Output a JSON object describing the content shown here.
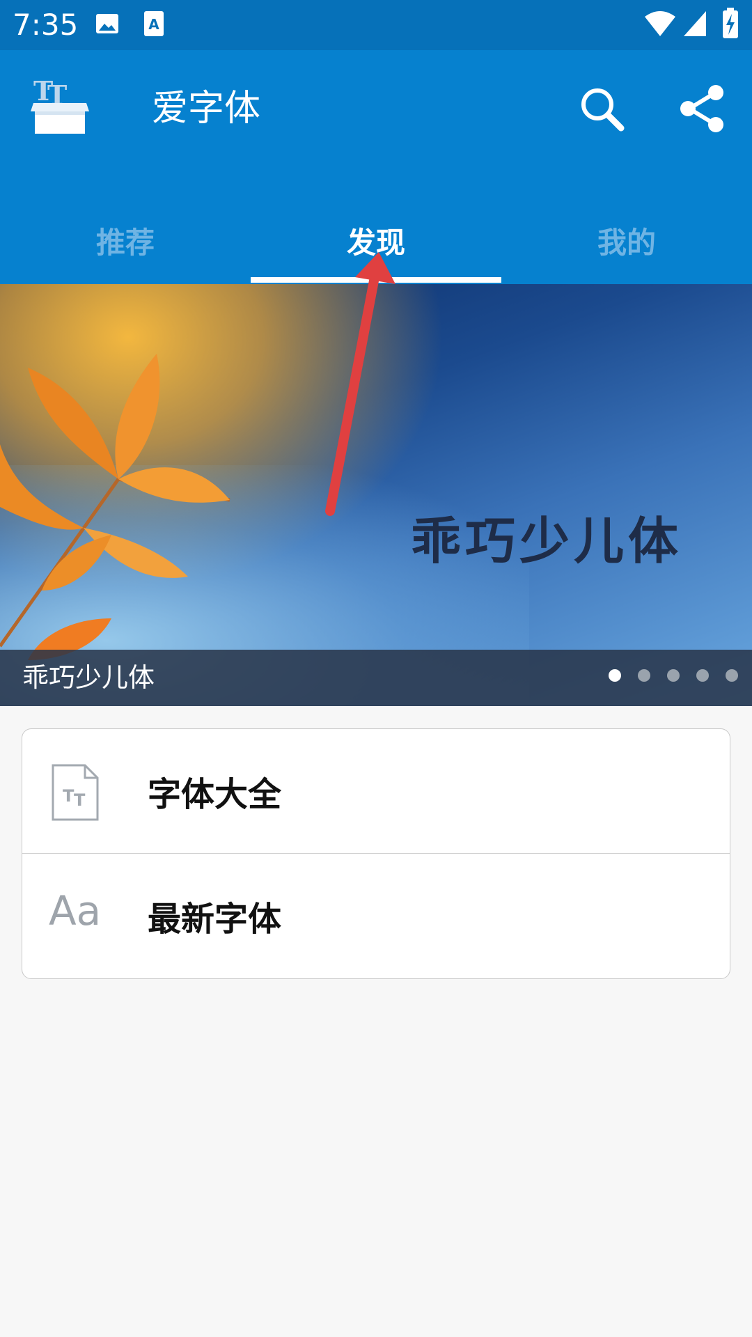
{
  "status_bar": {
    "time": "7:35",
    "icons": [
      "image-icon",
      "font-app-icon",
      "wifi-icon",
      "signal-icon",
      "battery-icon"
    ]
  },
  "app_bar": {
    "title": "爱字体",
    "actions": [
      "search-icon",
      "share-icon"
    ]
  },
  "tabs": [
    {
      "label": "推荐",
      "active": false
    },
    {
      "label": "发现",
      "active": true
    },
    {
      "label": "我的",
      "active": false
    }
  ],
  "banner": {
    "art_text": "乖巧少儿体",
    "caption": "乖巧少儿体",
    "page_count": 5,
    "active_index": 0
  },
  "menu": [
    {
      "label": "字体大全",
      "icon": "font-document-icon"
    },
    {
      "label": "最新字体",
      "icon": "aa-icon",
      "icon_text": "Aa"
    }
  ],
  "colors": {
    "status_bar": "#0671b9",
    "app_bar": "#0681cf",
    "tab_inactive": "#6fb4e4",
    "annotation_arrow": "#e04040",
    "background": "#f7f7f7"
  }
}
